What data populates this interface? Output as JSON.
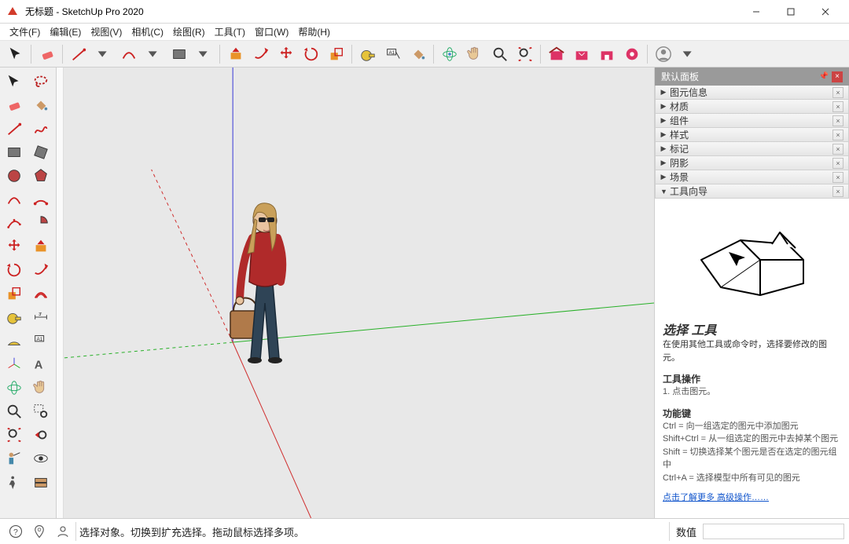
{
  "window": {
    "title": "无标题 - SketchUp Pro 2020",
    "app_icon_color": "#d23b2a"
  },
  "menubar": [
    {
      "label": "文件(F)"
    },
    {
      "label": "编辑(E)"
    },
    {
      "label": "视图(V)"
    },
    {
      "label": "相机(C)"
    },
    {
      "label": "绘图(R)"
    },
    {
      "label": "工具(T)"
    },
    {
      "label": "窗口(W)"
    },
    {
      "label": "帮助(H)"
    }
  ],
  "tray": {
    "header": "默认面板",
    "panels": [
      {
        "label": "图元信息",
        "expanded": false
      },
      {
        "label": "材质",
        "expanded": false
      },
      {
        "label": "组件",
        "expanded": false
      },
      {
        "label": "样式",
        "expanded": false
      },
      {
        "label": "标记",
        "expanded": false
      },
      {
        "label": "阴影",
        "expanded": false
      },
      {
        "label": "场景",
        "expanded": false
      },
      {
        "label": "工具向导",
        "expanded": true
      }
    ]
  },
  "instructor": {
    "tool_name": "选择 工具",
    "desc": "在使用其他工具或命令时，选择要修改的图元。",
    "op_header": "工具操作",
    "op_line": "1. 点击图元。",
    "mod_header": "功能键",
    "mod_lines": [
      "Ctrl = 向一组选定的图元中添加图元",
      "Shift+Ctrl = 从一组选定的图元中去掉某个图元",
      "Shift = 切换选择某个图元是否在选定的图元组中",
      "Ctrl+A = 选择模型中所有可见的图元"
    ],
    "more": "点击了解更多 高级操作……"
  },
  "statusbar": {
    "message": "选择对象。切换到扩充选择。拖动鼠标选择多项。",
    "value_label": "数值"
  }
}
